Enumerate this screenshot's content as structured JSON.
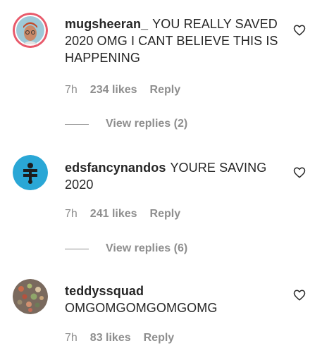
{
  "comments": [
    {
      "username": "mugsheeran_",
      "text": "YOU REALLY SAVED 2020 OMG I CANT BELIEVE THIS IS HAPPENING",
      "time": "7h",
      "likes": "234 likes",
      "reply": "Reply",
      "view_replies": "View replies (2)",
      "avatar": "red-ring-avatar"
    },
    {
      "username": "edsfancynandos",
      "text": "YOURE SAVING 2020",
      "time": "7h",
      "likes": "241 likes",
      "reply": "Reply",
      "view_replies": "View replies (6)",
      "avatar": "blue-symbol-avatar"
    },
    {
      "username": "teddyssquad",
      "text": "OMGOMGOMGOMGOMG",
      "time": "7h",
      "likes": "83 likes",
      "reply": "Reply",
      "avatar": "sprinkles-avatar"
    }
  ],
  "icons": {
    "like": "heart-outline-icon"
  },
  "colors": {
    "text": "#262626",
    "muted": "#8e8e8e",
    "avatar_blue": "#2aa7d6",
    "avatar_ring": "#e85a6b"
  }
}
